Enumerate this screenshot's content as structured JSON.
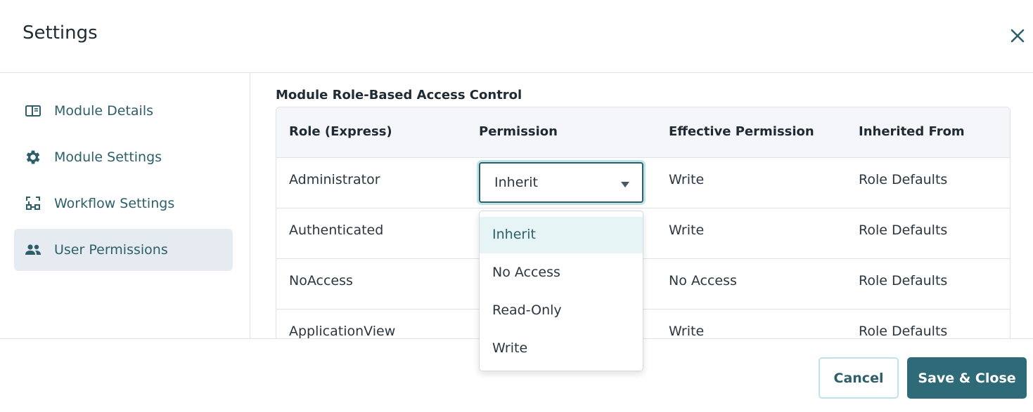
{
  "header": {
    "title": "Settings",
    "close_icon": "close-icon"
  },
  "sidebar": {
    "items": [
      {
        "label": "Module Details",
        "icon": "panel-icon",
        "active": false
      },
      {
        "label": "Module Settings",
        "icon": "gear-icon",
        "active": false
      },
      {
        "label": "Workflow Settings",
        "icon": "workflow-icon",
        "active": false
      },
      {
        "label": "User Permissions",
        "icon": "users-icon",
        "active": true
      }
    ]
  },
  "main": {
    "section_title": "Module Role-Based Access Control",
    "columns": [
      "Role (Express)",
      "Permission",
      "Effective Permission",
      "Inherited From"
    ],
    "rows": [
      {
        "role": "Administrator",
        "permission": "Inherit",
        "effective": "Write",
        "inherited_from": "Role Defaults"
      },
      {
        "role": "Authenticated",
        "permission": "",
        "effective": "Write",
        "inherited_from": "Role Defaults"
      },
      {
        "role": "NoAccess",
        "permission": "",
        "effective": "No Access",
        "inherited_from": "Role Defaults"
      },
      {
        "role": "ApplicationView",
        "permission": "",
        "effective": "Write",
        "inherited_from": "Role Defaults"
      }
    ],
    "dropdown": {
      "options": [
        "Inherit",
        "No Access",
        "Read-Only",
        "Write"
      ],
      "selected": "Inherit"
    }
  },
  "footer": {
    "cancel_label": "Cancel",
    "save_label": "Save & Close"
  },
  "colors": {
    "accent": "#2e6a77",
    "active_bg": "#e6ebf1",
    "focus_ring": "#bfe3e6"
  }
}
